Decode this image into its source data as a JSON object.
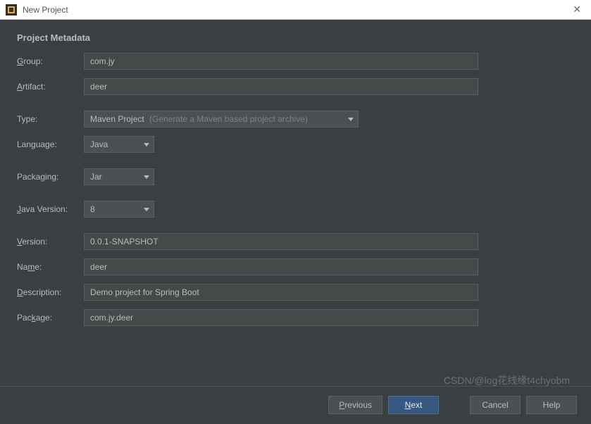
{
  "titlebar": {
    "title": "New Project",
    "close_glyph": "✕"
  },
  "section_title": "Project Metadata",
  "labels": {
    "group": "roup:",
    "group_mn": "G",
    "artifact": "rtifact:",
    "artifact_mn": "A",
    "type": "Type:",
    "language": "Language:",
    "packaging": "Packaging:",
    "java_version": "ava Version:",
    "java_version_mn": "J",
    "version": "ersion:",
    "version_mn": "V",
    "name": "Na",
    "name_mn": "m",
    "name_post": "e:",
    "description": "escription:",
    "description_mn": "D",
    "package": "Pac",
    "package_mn": "k",
    "package_post": "age:"
  },
  "fields": {
    "group": "com.jy",
    "artifact": "deer",
    "type": "Maven Project",
    "type_hint": "(Generate a Maven based project archive)",
    "language": "Java",
    "packaging": "Jar",
    "java_version": "8",
    "version": "0.0.1-SNAPSHOT",
    "name": "deer",
    "description": "Demo project for Spring Boot",
    "package": "com.jy.deer"
  },
  "buttons": {
    "previous": "revious",
    "previous_mn": "P",
    "next": "ext",
    "next_mn": "N",
    "cancel": "Cancel",
    "help": "Help"
  },
  "watermark": "CSDN/@log花线缘t4chyobm"
}
